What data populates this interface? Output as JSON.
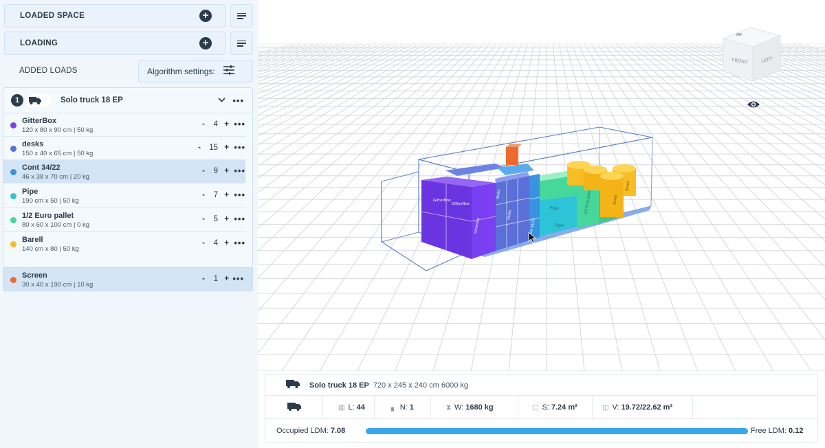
{
  "left": {
    "loaded_space_label": "LOADED SPACE",
    "loading_label": "LOADING",
    "added_loads_label": "ADDED LOADS",
    "algorithm_settings_label": "Algorithm settings:"
  },
  "truck": {
    "index": "1",
    "name": "Solo truck 18 EP",
    "loads": [
      {
        "name": "GitterBox",
        "dims": "120 x 80 x 90 cm | 50 kg",
        "qty": "4",
        "color": "#7a3ff0"
      },
      {
        "name": "desks",
        "dims": "150 x 40 x 65 cm | 50 kg",
        "qty": "15",
        "color": "#5a6fd8"
      },
      {
        "name": "Cont 34/22",
        "dims": "46 x 38 x 70 cm | 20 kg",
        "qty": "9",
        "color": "#3a93e0"
      },
      {
        "name": "Pipe",
        "dims": "190 cm x 50 | 50 kg",
        "qty": "7",
        "color": "#2ec4d8"
      },
      {
        "name": "1/2 Euro pallet",
        "dims": "80 x 60 x 100 cm | 0 kg",
        "qty": "5",
        "color": "#46d79a"
      },
      {
        "name": "Barell",
        "dims": "140 cm x 80 | 50 kg",
        "qty": "4",
        "color": "#f7bd24"
      }
    ]
  },
  "screen_load": {
    "name": "Screen",
    "dims": "30 x 40 x 190 cm | 10 kg",
    "qty": "1",
    "color": "#ee6a2c"
  },
  "controls": {
    "minus": "-",
    "plus": "+",
    "more": "•••"
  },
  "viewcube": {
    "front": "FRONT",
    "left": "LEFT"
  },
  "info": {
    "truck_name": "Solo truck 18 EP",
    "truck_spec": "720 x 245 x 240 cm 6000 kg",
    "l_label": "L:",
    "l_value": "44",
    "n_label": "N:",
    "n_value": "1",
    "w_label": "W:",
    "w_value": "1680 kg",
    "s_label": "S:",
    "s_value": "7.24 m²",
    "v_label": "V:",
    "v_value": "19.72/22.62 m³",
    "occupied_label": "Occupied LDM:",
    "occupied_value": "7.08",
    "free_label": "Free LDM:",
    "free_value": "0.12"
  },
  "cargo_labels": {
    "gitterbox": "GitterBox",
    "desks": "desks",
    "cont": "Cont 34/22",
    "pipe": "Pipe",
    "pallet": "1/2 Euro pallet",
    "barell": "Barell"
  }
}
